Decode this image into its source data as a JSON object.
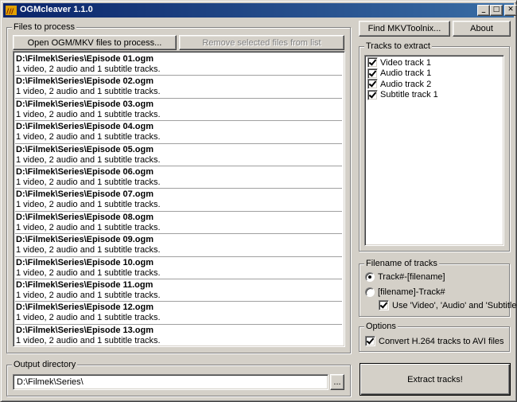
{
  "window": {
    "title": "OGMcleaver 1.1.0",
    "controls": {
      "minimize": "_",
      "maximize": "□",
      "close": "✕"
    }
  },
  "files_group": {
    "legend": "Files to process",
    "open_button": "Open OGM/MKV files to process...",
    "remove_button": "Remove selected files from list",
    "files": [
      {
        "name": "D:\\Filmek\\Series\\Episode 01.ogm",
        "info": "1 video, 2 audio and 1 subtitle tracks."
      },
      {
        "name": "D:\\Filmek\\Series\\Episode 02.ogm",
        "info": "1 video, 2 audio and 1 subtitle tracks."
      },
      {
        "name": "D:\\Filmek\\Series\\Episode 03.ogm",
        "info": "1 video, 2 audio and 1 subtitle tracks."
      },
      {
        "name": "D:\\Filmek\\Series\\Episode 04.ogm",
        "info": "1 video, 2 audio and 1 subtitle tracks."
      },
      {
        "name": "D:\\Filmek\\Series\\Episode 05.ogm",
        "info": "1 video, 2 audio and 1 subtitle tracks."
      },
      {
        "name": "D:\\Filmek\\Series\\Episode 06.ogm",
        "info": "1 video, 2 audio and 1 subtitle tracks."
      },
      {
        "name": "D:\\Filmek\\Series\\Episode 07.ogm",
        "info": "1 video, 2 audio and 1 subtitle tracks."
      },
      {
        "name": "D:\\Filmek\\Series\\Episode 08.ogm",
        "info": "1 video, 2 audio and 1 subtitle tracks."
      },
      {
        "name": "D:\\Filmek\\Series\\Episode 09.ogm",
        "info": "1 video, 2 audio and 1 subtitle tracks."
      },
      {
        "name": "D:\\Filmek\\Series\\Episode 10.ogm",
        "info": "1 video, 2 audio and 1 subtitle tracks."
      },
      {
        "name": "D:\\Filmek\\Series\\Episode 11.ogm",
        "info": "1 video, 2 audio and 1 subtitle tracks."
      },
      {
        "name": "D:\\Filmek\\Series\\Episode 12.ogm",
        "info": "1 video, 2 audio and 1 subtitle tracks."
      },
      {
        "name": "D:\\Filmek\\Series\\Episode 13.ogm",
        "info": "1 video, 2 audio and 1 subtitle tracks."
      }
    ]
  },
  "output_group": {
    "legend": "Output directory",
    "path": "D:\\Filmek\\Series\\",
    "browse_button": "..."
  },
  "top_buttons": {
    "find_mkvtoolnix": "Find MKVToolnix...",
    "about": "About"
  },
  "tracks_group": {
    "legend": "Tracks to extract",
    "tracks": [
      {
        "label": "Video track 1",
        "checked": true
      },
      {
        "label": "Audio track 1",
        "checked": true
      },
      {
        "label": "Audio track 2",
        "checked": true
      },
      {
        "label": "Subtitle track 1",
        "checked": true
      }
    ]
  },
  "filename_group": {
    "legend": "Filename of tracks",
    "option_1": "Track#-[filename]",
    "option_1_selected": true,
    "option_2": "[filename]-Track#",
    "option_2_selected": false,
    "use_names_label": "Use 'Video', 'Audio' and 'Subtitle'",
    "use_names_checked": true
  },
  "options_group": {
    "legend": "Options",
    "convert_label": "Convert H.264 tracks to AVI files",
    "convert_checked": true
  },
  "extract_button": "Extract tracks!"
}
